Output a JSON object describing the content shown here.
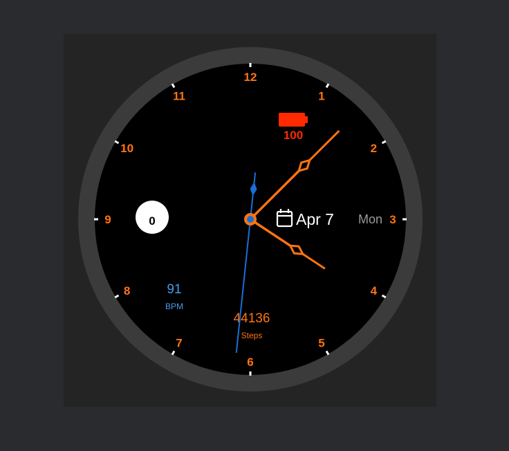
{
  "colors": {
    "accent": "#ff7410",
    "hour_numeral": "#ff7410",
    "second_hand": "#1a6fd6",
    "heart_rate": "#4a9be8",
    "battery": "#ff2a00",
    "bezel": "#3b3b3b",
    "dial": "#000000",
    "date_text": "#ffffff",
    "weekday_text": "#9a9a9a"
  },
  "dial": {
    "numerals": [
      "12",
      "1",
      "2",
      "3",
      "4",
      "5",
      "6",
      "7",
      "8",
      "9",
      "10",
      "11"
    ]
  },
  "time": {
    "hour": 4,
    "minute": 7,
    "second": 31
  },
  "complications": {
    "battery": {
      "value": "100",
      "icon": "battery-full-icon"
    },
    "date": {
      "icon": "calendar-icon",
      "text": "Apr 7"
    },
    "weekday": {
      "text": "Mon"
    },
    "notifications": {
      "count": "0"
    },
    "heart_rate": {
      "value": "91",
      "unit": "BPM"
    },
    "steps": {
      "value": "44136",
      "unit": "Steps"
    }
  }
}
